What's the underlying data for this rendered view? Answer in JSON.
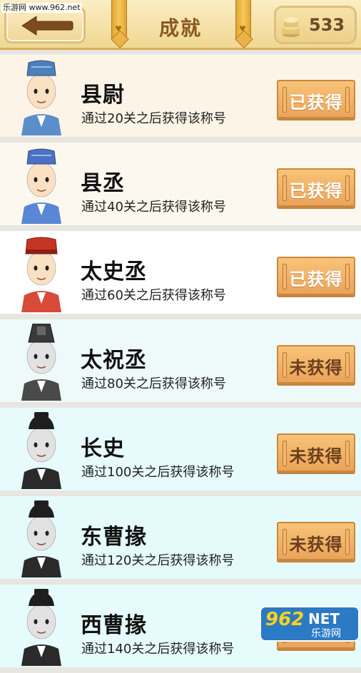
{
  "watermark_top": "乐游网 www.962.net",
  "header": {
    "title": "成就",
    "coins": "533"
  },
  "achievements": [
    {
      "name": "县尉",
      "desc": "通过20关之后获得该称号",
      "status": "已获得",
      "bg": "#fcf4e6",
      "hat": "#4f7fb8",
      "robe": "#5b8fca",
      "style": "blue"
    },
    {
      "name": "县丞",
      "desc": "通过40关之后获得该称号",
      "status": "已获得",
      "bg": "#fcf8ef",
      "hat": "#4d6fc4",
      "robe": "#5a86d6",
      "style": "blue"
    },
    {
      "name": "太史丞",
      "desc": "通过60关之后获得该称号",
      "status": "已获得",
      "bg": "#ffffff",
      "hat": "#c43528",
      "robe": "#d84a3a",
      "style": "red"
    },
    {
      "name": "太祝丞",
      "desc": "通过80关之后获得该称号",
      "status": "未获得",
      "bg": "#eefafa",
      "hat": "#3a3a3a",
      "robe": "#4a4a4a",
      "style": "gray"
    },
    {
      "name": "长史",
      "desc": "通过100关之后获得该称号",
      "status": "未获得",
      "bg": "#e7fbfc",
      "hat": "#1e1e1e",
      "robe": "#2a2a2a",
      "style": "black"
    },
    {
      "name": "东曹掾",
      "desc": "通过120关之后获得该称号",
      "status": "未获得",
      "bg": "#e4fafb",
      "hat": "#1e1e1e",
      "robe": "#2a2a2a",
      "style": "black"
    },
    {
      "name": "西曹掾",
      "desc": "通过140关之后获得该称号",
      "status": "未获得",
      "bg": "#e6fbfc",
      "hat": "#1e1e1e",
      "robe": "#2a2a2a",
      "style": "black"
    }
  ],
  "watermark_bottom": {
    "num": "962",
    "net": "NET",
    "cn": "乐游网"
  }
}
